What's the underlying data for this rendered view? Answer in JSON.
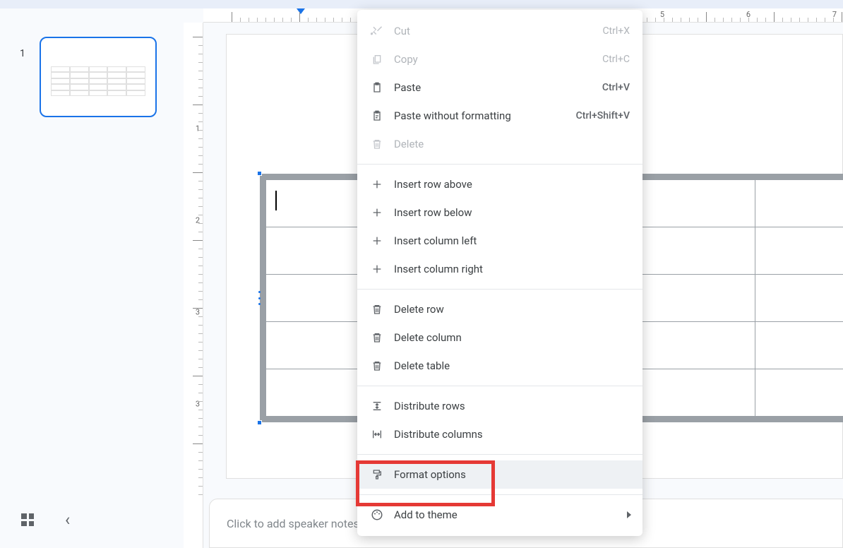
{
  "slide_number": "1",
  "ruler": {
    "labels": [
      "5",
      "6",
      "7"
    ],
    "vlabels": [
      "1",
      "2",
      "3"
    ]
  },
  "context_menu": {
    "cut": "Cut",
    "cut_acc": "Ctrl+X",
    "copy": "Copy",
    "copy_acc": "Ctrl+C",
    "paste": "Paste",
    "paste_acc": "Ctrl+V",
    "paste_plain": "Paste without formatting",
    "paste_plain_acc": "Ctrl+Shift+V",
    "delete": "Delete",
    "insert_row_above": "Insert row above",
    "insert_row_below": "Insert row below",
    "insert_col_left": "Insert column left",
    "insert_col_right": "Insert column right",
    "delete_row": "Delete row",
    "delete_column": "Delete column",
    "delete_table": "Delete table",
    "distribute_rows": "Distribute rows",
    "distribute_cols": "Distribute columns",
    "format_options": "Format options",
    "add_to_theme": "Add to theme"
  },
  "notes_placeholder": "Click to add speaker notes"
}
